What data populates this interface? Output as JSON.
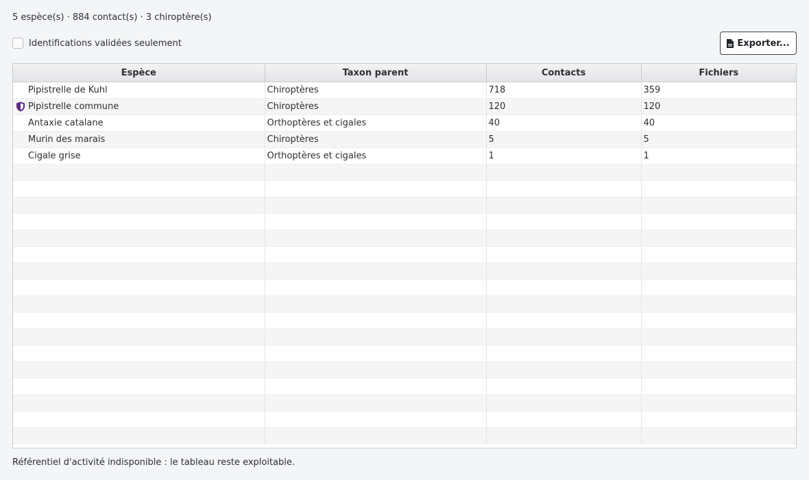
{
  "summary": "5 espèce(s) · 884 contact(s) · 3 chiroptère(s)",
  "filter": {
    "label": "Identifications validées seulement",
    "checked": false
  },
  "export_button": {
    "label": "Exporter...",
    "icon": "file-icon"
  },
  "table": {
    "columns": [
      "Espèce",
      "Taxon parent",
      "Contacts",
      "Fichiers"
    ],
    "rows": [
      {
        "species": "Pipistrelle de Kuhl",
        "taxon": "Chiroptères",
        "contacts": "718",
        "files": "359",
        "icon": ""
      },
      {
        "species": "Pipistrelle commune",
        "taxon": "Chiroptères",
        "contacts": "120",
        "files": "120",
        "icon": "shield-icon"
      },
      {
        "species": "Antaxie catalane",
        "taxon": "Orthoptères et cigales",
        "contacts": "40",
        "files": "40",
        "icon": ""
      },
      {
        "species": "Murin des marais",
        "taxon": "Chiroptères",
        "contacts": "5",
        "files": "5",
        "icon": ""
      },
      {
        "species": "Cigale grise",
        "taxon": "Orthoptères et cigales",
        "contacts": "1",
        "files": "1",
        "icon": ""
      }
    ]
  },
  "colors": {
    "shield_icon": "#5b2a86"
  },
  "status": "Référentiel d'activité indisponible : le tableau reste exploitable."
}
